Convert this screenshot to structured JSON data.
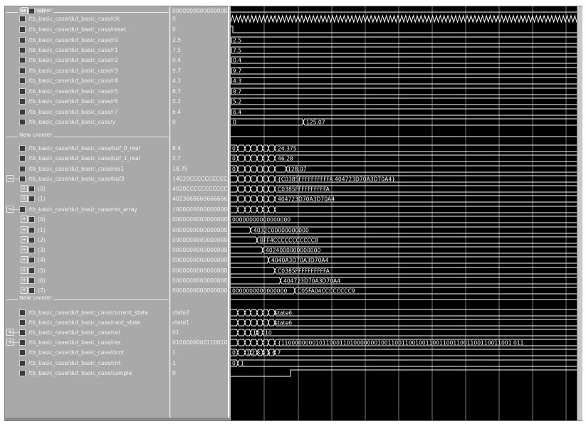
{
  "dividers": [
    {
      "label": "New Divider"
    },
    {
      "label": "New Divider"
    },
    {
      "label": "New Divider"
    }
  ],
  "signals": [
    {
      "name": "/tb_basic_case/dut_basic_case/clk",
      "value": "0"
    },
    {
      "name": "/tb_basic_case/dut_basic_case/reset",
      "value": "0"
    },
    {
      "name": "/tb_basic_case/dut_basic_case/r0",
      "value": "2.5",
      "wave": "2.5"
    },
    {
      "name": "/tb_basic_case/dut_basic_case/r1",
      "value": "7.5",
      "wave": "7.5"
    },
    {
      "name": "/tb_basic_case/dut_basic_case/r2",
      "value": "0.4",
      "wave": "0.4"
    },
    {
      "name": "/tb_basic_case/dut_basic_case/r3",
      "value": "9.7",
      "wave": "9.7"
    },
    {
      "name": "/tb_basic_case/dut_basic_case/r4",
      "value": "4.3",
      "wave": "4.3"
    },
    {
      "name": "/tb_basic_case/dut_basic_case/r5",
      "value": "8.7",
      "wave": "8.7"
    },
    {
      "name": "/tb_basic_case/dut_basic_case/r6",
      "value": "5.2",
      "wave": "5.2"
    },
    {
      "name": "/tb_basic_case/dut_basic_case/r7",
      "value": "6.4",
      "wave": "6.4"
    },
    {
      "name": "/tb_basic_case/dut_basic_case/y",
      "value": "0",
      "wave": "0",
      "wave2": "125.07"
    },
    {
      "name": "/tb_basic_case/dut_basic_case/buf_0_real",
      "value": "8.4",
      "wave": "0",
      "wave2": "24.375"
    },
    {
      "name": "/tb_basic_case/dut_basic_case/buf_1_real",
      "value": "5.7",
      "wave": "0",
      "wave2": "46.28"
    },
    {
      "name": "/tb_basic_case/dut_basic_case/res1",
      "value": "18.75",
      "wave": "0",
      "wave2": "128.07"
    },
    {
      "name": "/tb_basic_case/dut_basic_case/buf3",
      "value": "{4020CCCCCCCCCCCD",
      "wave2": "{C0385FFFFFFFFFFA 404723D70A3D70A4}"
    },
    {
      "name": "(0)",
      "value": "4020CCCCCCCCCCCD",
      "wave2": "C0385FFFFFFFFFFA"
    },
    {
      "name": "(1)",
      "value": "4023666666666666",
      "wave2": "404723D70A3D70A4"
    },
    {
      "name": "/tb_basic_case/dut_basic_case/res_array",
      "value": "{0000000000000000"
    },
    {
      "name": "(0)",
      "value": "0000000000000000",
      "wave": "00000000000000000"
    },
    {
      "name": "(1)",
      "value": "0000000000000000",
      "wave2": "4032C00000000000"
    },
    {
      "name": "(2)",
      "value": "0000000000000000",
      "wave2": "BFF4CCCCCCCCCCC8"
    },
    {
      "name": "(3)",
      "value": "0000000000000000",
      "wave2": "4024000000000000"
    },
    {
      "name": "(4)",
      "value": "0000000000000000",
      "wave2": "4040A3D70A3D70A4"
    },
    {
      "name": "(5)",
      "value": "0000000000000000",
      "wave2": "C0385FFFFFFFFFFA"
    },
    {
      "name": "(6)",
      "value": "0000000000000000",
      "wave2": "404723D70A3D70A4"
    },
    {
      "name": "(7)",
      "value": "0000000000000000",
      "wave": "0000000000000000",
      "wave2": "C05FA04CCCCCCCC9"
    },
    {
      "name": "(8)",
      "value": "0000000000000000",
      "wave": "00000000000000000"
    },
    {
      "name": "/tb_basic_case/dut_basic_case/current_state",
      "value": "state2",
      "wave2": "state6"
    },
    {
      "name": "/tb_basic_case/dut_basic_case/next_state",
      "value": "state1",
      "wave2": "state6"
    },
    {
      "name": "/tb_basic_case/dut_basic_case/sel",
      "value": "01",
      "wave": "10",
      "wave2": "10"
    },
    {
      "name": "/tb_basic_case/dut_basic_case/res",
      "value": "0100000000110010",
      "wave2": "{1100000000101100011010000000100110011001001100110011001100110011001 011"
    },
    {
      "name": "/tb_basic_case/dut_basic_case/dcnt",
      "value": "1",
      "wave": "0",
      "wave2": "1 2 3 4 5 6 7"
    },
    {
      "name": "/tb_basic_case/dut_basic_case/cnt",
      "value": "1",
      "wave": "0",
      "wave2": "1"
    },
    {
      "name": "/tb_basic_case/dut_basic_case/sample",
      "value": "0"
    }
  ],
  "colors": {
    "waveform_bg": "#000000",
    "trace": "#ffffff",
    "grid": "#7a7a7a",
    "panel": "#a9a9a9"
  }
}
